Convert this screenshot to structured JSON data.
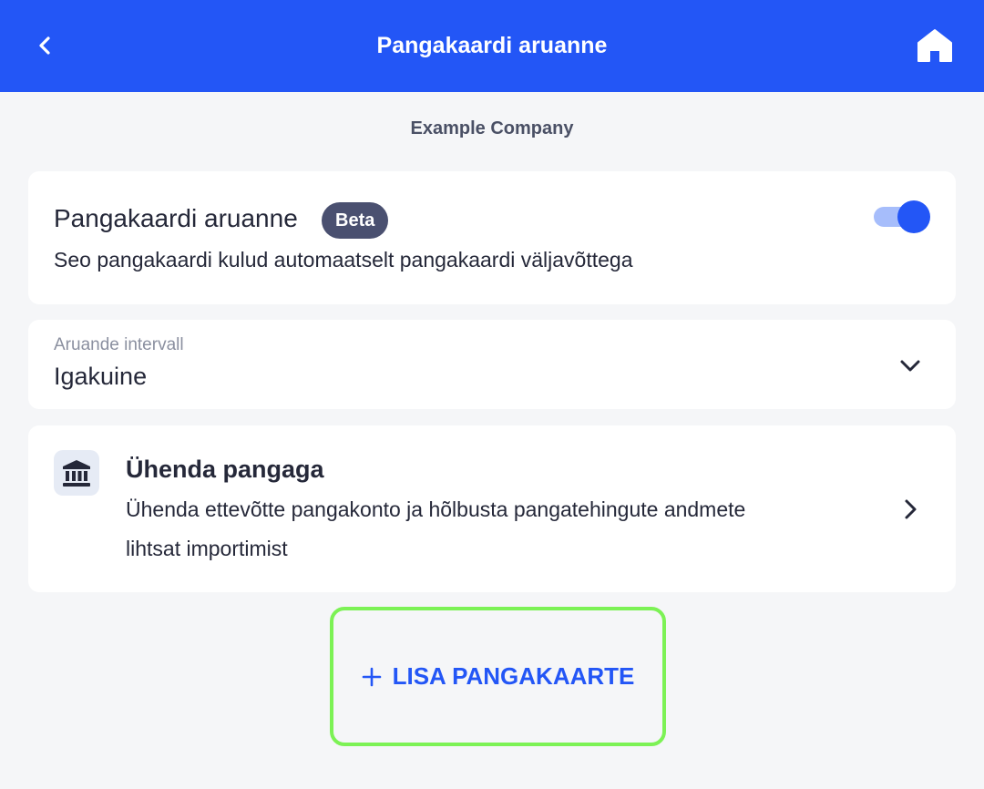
{
  "header": {
    "title": "Pangakaardi aruanne",
    "back_icon": "chevron-left-icon",
    "home_icon": "home-icon",
    "background_color": "#2356f6"
  },
  "company": {
    "name": "Example Company"
  },
  "report_card": {
    "title": "Pangakaardi aruanne",
    "badge": "Beta",
    "description": "Seo pangakaardi kulud automaatselt pangakaardi väljavõttega",
    "toggle_on": true
  },
  "interval": {
    "label": "Aruande intervall",
    "value": "Igakuine",
    "icon": "chevron-down-icon"
  },
  "bank_card": {
    "icon": "bank-icon",
    "title": "Ühenda pangaga",
    "description_line1": "Ühenda ettevõtte pangakonto ja hõlbusta pangatehingute andmete",
    "description_line2": "lihtsat importimist",
    "chevron_icon": "chevron-right-icon"
  },
  "add_card_button": {
    "icon": "plus-icon",
    "label": "LISA PANGAKAARTE",
    "text_color": "#2356f6",
    "highlight_color": "#7cf255"
  }
}
